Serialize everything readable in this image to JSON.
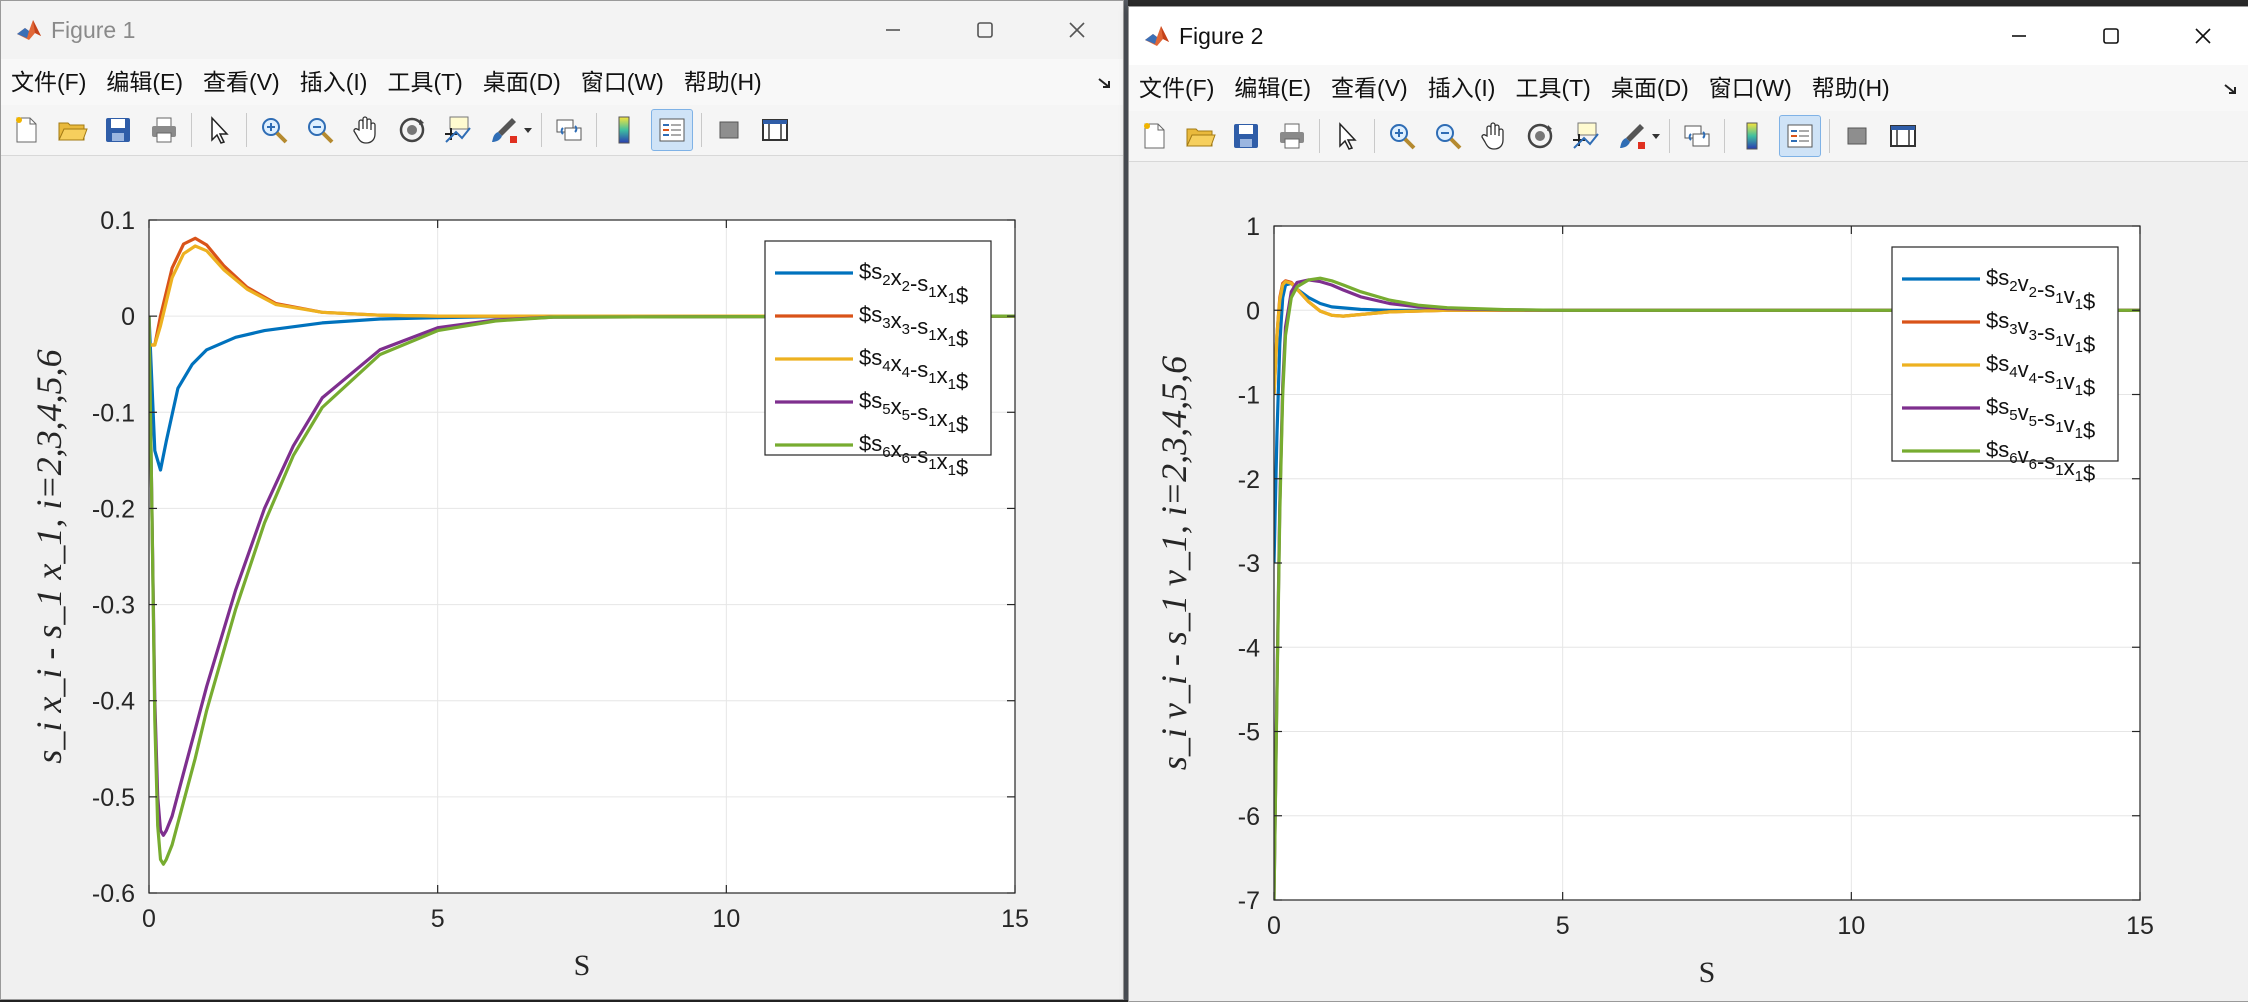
{
  "windows": [
    {
      "title": "Figure 1",
      "menu": [
        "文件(F)",
        "编辑(E)",
        "查看(V)",
        "插入(I)",
        "工具(T)",
        "桌面(D)",
        "窗口(W)",
        "帮助(H)"
      ],
      "toolbar_icons": [
        "new-figure-icon",
        "open-file-icon",
        "save-icon",
        "print-icon",
        "pointer-icon",
        "zoom-in-icon",
        "zoom-out-icon",
        "pan-hand-icon",
        "rotate-3d-icon",
        "data-cursor-icon",
        "brush-icon",
        "link-plot-icon",
        "colorbar-icon",
        "legend-icon",
        "hide-plot-tools-icon",
        "show-plot-tools-icon"
      ],
      "title_icon": "matlab-logo-icon",
      "window_controls": [
        "minimize-icon",
        "maximize-icon",
        "close-icon"
      ]
    },
    {
      "title": "Figure 2",
      "menu": [
        "文件(F)",
        "编辑(E)",
        "查看(V)",
        "插入(I)",
        "工具(T)",
        "桌面(D)",
        "窗口(W)",
        "帮助(H)"
      ],
      "toolbar_icons": [
        "new-figure-icon",
        "open-file-icon",
        "save-icon",
        "print-icon",
        "pointer-icon",
        "zoom-in-icon",
        "zoom-out-icon",
        "pan-hand-icon",
        "rotate-3d-icon",
        "data-cursor-icon",
        "brush-icon",
        "link-plot-icon",
        "colorbar-icon",
        "legend-icon",
        "hide-plot-tools-icon",
        "show-plot-tools-icon"
      ],
      "title_icon": "matlab-logo-icon",
      "window_controls": [
        "minimize-icon",
        "maximize-icon",
        "close-icon"
      ]
    }
  ],
  "colors": {
    "series": [
      "#0072BD",
      "#D95319",
      "#EDB120",
      "#7E2F8E",
      "#77AC30"
    ],
    "axes_bg": "#ffffff",
    "grid": "#e6e6e6",
    "figure_bg": "#f0f0f0"
  },
  "chart_data": [
    {
      "type": "line",
      "xlabel": "S",
      "ylabel": "s_i x_i - s_1 x_1, i=2,3,4,5,6",
      "xlim": [
        0,
        15
      ],
      "ylim": [
        -0.6,
        0.1
      ],
      "xticks": [
        "0",
        "5",
        "10",
        "15"
      ],
      "yticks": [
        "0.1",
        "0",
        "-0.1",
        "-0.2",
        "-0.3",
        "-0.4",
        "-0.5",
        "-0.6"
      ],
      "grid": true,
      "legend_position": "top-right",
      "series": [
        {
          "name": "$s2x2-s1x1$",
          "x": [
            0,
            0.1,
            0.2,
            0.3,
            0.5,
            0.75,
            1,
            1.5,
            2,
            3,
            4,
            5,
            6,
            8,
            15
          ],
          "y": [
            0,
            -0.14,
            -0.16,
            -0.13,
            -0.075,
            -0.05,
            -0.035,
            -0.022,
            -0.015,
            -0.007,
            -0.003,
            -0.0015,
            -0.0005,
            0,
            0
          ]
        },
        {
          "name": "$s3x3-s1x1$",
          "x": [
            0,
            0.1,
            0.2,
            0.4,
            0.6,
            0.8,
            1.0,
            1.3,
            1.7,
            2.2,
            3,
            4,
            5,
            15
          ],
          "y": [
            -0.03,
            -0.03,
            0.0,
            0.05,
            0.075,
            0.081,
            0.074,
            0.052,
            0.03,
            0.013,
            0.004,
            0.001,
            0,
            0
          ]
        },
        {
          "name": "$s4x4-s1x1$",
          "x": [
            0,
            0.1,
            0.2,
            0.4,
            0.6,
            0.8,
            1.0,
            1.3,
            1.7,
            2.2,
            3,
            4,
            5,
            15
          ],
          "y": [
            -0.03,
            -0.03,
            -0.01,
            0.04,
            0.065,
            0.073,
            0.068,
            0.048,
            0.028,
            0.012,
            0.004,
            0.001,
            0,
            0
          ]
        },
        {
          "name": "$s5x5-s1x1$",
          "x": [
            0,
            0.05,
            0.1,
            0.15,
            0.2,
            0.25,
            0.3,
            0.4,
            0.6,
            0.8,
            1,
            1.5,
            2,
            2.5,
            3,
            4,
            5,
            6,
            7,
            15
          ],
          "y": [
            0,
            -0.2,
            -0.4,
            -0.5,
            -0.535,
            -0.54,
            -0.535,
            -0.52,
            -0.475,
            -0.43,
            -0.385,
            -0.285,
            -0.2,
            -0.135,
            -0.085,
            -0.035,
            -0.012,
            -0.004,
            -0.001,
            0
          ]
        },
        {
          "name": "$s6x6-s1x1$",
          "x": [
            0,
            0.05,
            0.1,
            0.15,
            0.2,
            0.25,
            0.3,
            0.4,
            0.6,
            0.8,
            1,
            1.5,
            2,
            2.5,
            3,
            4,
            5,
            6,
            7,
            15
          ],
          "y": [
            0,
            -0.2,
            -0.42,
            -0.53,
            -0.565,
            -0.57,
            -0.565,
            -0.55,
            -0.505,
            -0.46,
            -0.41,
            -0.305,
            -0.215,
            -0.145,
            -0.095,
            -0.04,
            -0.015,
            -0.005,
            -0.001,
            0
          ]
        }
      ]
    },
    {
      "type": "line",
      "xlabel": "S",
      "ylabel": "s_i v_i - s_1 v_1, i=2,3,4,5,6",
      "xlim": [
        0,
        15
      ],
      "ylim": [
        -7,
        1
      ],
      "xticks": [
        "0",
        "5",
        "10",
        "15"
      ],
      "yticks": [
        "1",
        "0",
        "-1",
        "-2",
        "-3",
        "-4",
        "-5",
        "-6",
        "-7"
      ],
      "grid": true,
      "legend_position": "top-right",
      "series": [
        {
          "name": "$s2v2-s1v1$",
          "x": [
            0,
            0.05,
            0.1,
            0.15,
            0.2,
            0.3,
            0.4,
            0.6,
            0.8,
            1,
            1.5,
            2,
            3,
            4,
            15
          ],
          "y": [
            -3,
            -1.5,
            -0.4,
            0.15,
            0.3,
            0.32,
            0.25,
            0.15,
            0.08,
            0.04,
            0.01,
            0,
            0,
            0,
            0
          ]
        },
        {
          "name": "$s3v3-s1v1$",
          "x": [
            0,
            0.05,
            0.1,
            0.15,
            0.2,
            0.3,
            0.4,
            0.6,
            0.8,
            1,
            1.2,
            1.5,
            2,
            3,
            4,
            15
          ],
          "y": [
            -1,
            -0.3,
            0.15,
            0.32,
            0.35,
            0.33,
            0.25,
            0.1,
            -0.01,
            -0.06,
            -0.07,
            -0.05,
            -0.02,
            0,
            0,
            0
          ]
        },
        {
          "name": "$s4v4-s1v1$",
          "x": [
            0,
            0.05,
            0.1,
            0.15,
            0.2,
            0.3,
            0.4,
            0.6,
            0.8,
            1,
            1.2,
            1.5,
            2,
            3,
            4,
            15
          ],
          "y": [
            -1,
            -0.3,
            0.12,
            0.3,
            0.34,
            0.32,
            0.25,
            0.1,
            -0.01,
            -0.06,
            -0.07,
            -0.05,
            -0.02,
            0,
            0,
            0
          ]
        },
        {
          "name": "$s5v5-s1v1$",
          "x": [
            0,
            0.05,
            0.1,
            0.15,
            0.2,
            0.3,
            0.4,
            0.6,
            0.8,
            1,
            1.2,
            1.5,
            2,
            2.5,
            3,
            4,
            5,
            15
          ],
          "y": [
            -7,
            -4.5,
            -2.3,
            -0.9,
            -0.2,
            0.22,
            0.33,
            0.36,
            0.34,
            0.3,
            0.24,
            0.16,
            0.08,
            0.04,
            0.02,
            0.005,
            0,
            0
          ]
        },
        {
          "name": "$s6v6-s1x1$",
          "x": [
            0,
            0.05,
            0.1,
            0.15,
            0.2,
            0.3,
            0.4,
            0.6,
            0.8,
            1,
            1.2,
            1.5,
            2,
            2.5,
            3,
            4,
            5,
            15
          ],
          "y": [
            -7,
            -4.6,
            -2.4,
            -1.0,
            -0.3,
            0.15,
            0.28,
            0.36,
            0.38,
            0.35,
            0.3,
            0.22,
            0.12,
            0.06,
            0.03,
            0.008,
            0,
            0
          ]
        }
      ]
    }
  ]
}
